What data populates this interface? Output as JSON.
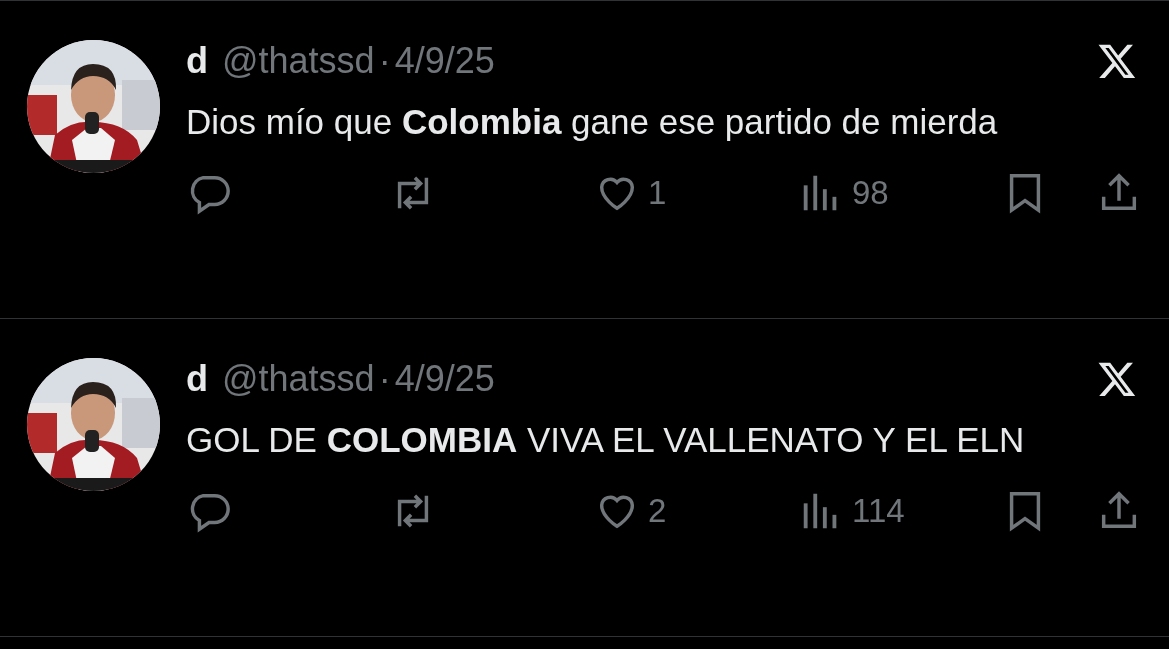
{
  "tweets": [
    {
      "name": "d",
      "handle": "@thatssd",
      "separator": "·",
      "date": "4/9/25",
      "text": "Dios mío que **Colombia** gane ese partido de mierda",
      "likes": "1",
      "views": "98"
    },
    {
      "name": "d",
      "handle": "@thatssd",
      "separator": "·",
      "date": "4/9/25",
      "text": "GOL DE **COLOMBIA** VIVA EL VALLENATO Y EL ELN",
      "likes": "2",
      "views": "114"
    }
  ]
}
